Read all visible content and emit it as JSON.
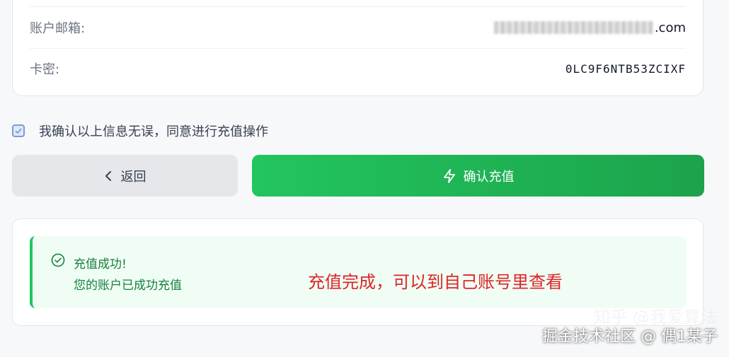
{
  "info": {
    "email_label": "账户邮箱:",
    "email_suffix": ".com",
    "card_key_label": "卡密:",
    "card_key_value": "0LC9F6NTB53ZCIXF"
  },
  "confirm": {
    "checked": true,
    "text": "我确认以上信息无误，同意进行充值操作"
  },
  "buttons": {
    "back_label": "返回",
    "confirm_label": "确认充值",
    "confirm_color": "#22c55e"
  },
  "result": {
    "title": "充值成功!",
    "message": "您的账户已成功充值",
    "annotation": "充值完成，可以到自己账号里查看",
    "annotation_color": "#dc2626"
  },
  "watermark": {
    "line1": "知乎 @我爱算法",
    "line2": "掘金技术社区 @ 偶1某子"
  }
}
